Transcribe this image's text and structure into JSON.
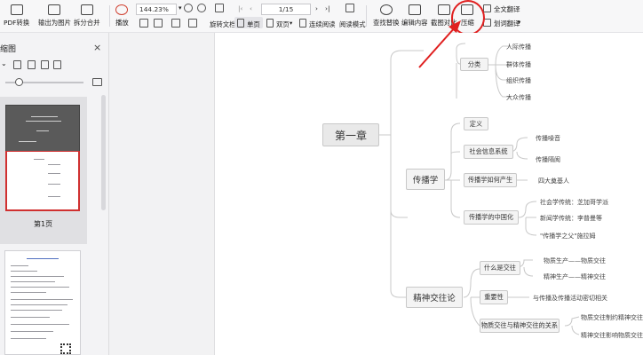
{
  "toolbar": {
    "pdf_convert": "PDF转换",
    "export_image": "输出为图片",
    "split_merge": "拆分合并",
    "play": "播放",
    "zoom": "144.23%",
    "page": "1/15",
    "rotate": "旋转文档",
    "single_page": "单页",
    "double_page": "双页",
    "continuous": "连续阅读",
    "read_mode": "阅读模式",
    "find_replace": "查找替换",
    "edit_content": "编辑内容",
    "screenshot_compare": "截图对比",
    "compress": "压缩",
    "full_translate": "全文翻译",
    "word_translate": "划词翻译"
  },
  "sidebar": {
    "title": "缩图",
    "thumb1_label": "第1页"
  },
  "mindmap": {
    "chapter": "第一章",
    "branch_spread": "传播学",
    "branch_exchange": "精神交往论",
    "classification": "分类",
    "class_items": [
      "人际传播",
      "群体传播",
      "组织传播",
      "大众传播"
    ],
    "definition": "定义",
    "social_info": "社会信息系统",
    "social_info_items": [
      "传播噪音",
      "传播隔阂"
    ],
    "how_born": "传播学如何产生",
    "how_born_item": "四大奠基人",
    "in_china": "传播学的中国化",
    "china_items": [
      "社会学传统：芝加哥学派",
      "新闻学传统：李普曼等",
      "\"传播学之父\"施拉姆"
    ],
    "what_is": "什么是交往",
    "what_is_items": [
      "物质生产——物质交往",
      "精神生产——精神交往"
    ],
    "importance": "重要性",
    "importance_item": "与传播及传播活动密切相关",
    "relation": "物质交往与精神交往的关系",
    "relation_items": [
      "物质交往制约精神交往",
      "精神交往影响物质交往"
    ]
  },
  "colors": {
    "accent": "#e02020",
    "node_border": "#c8c8c8"
  }
}
